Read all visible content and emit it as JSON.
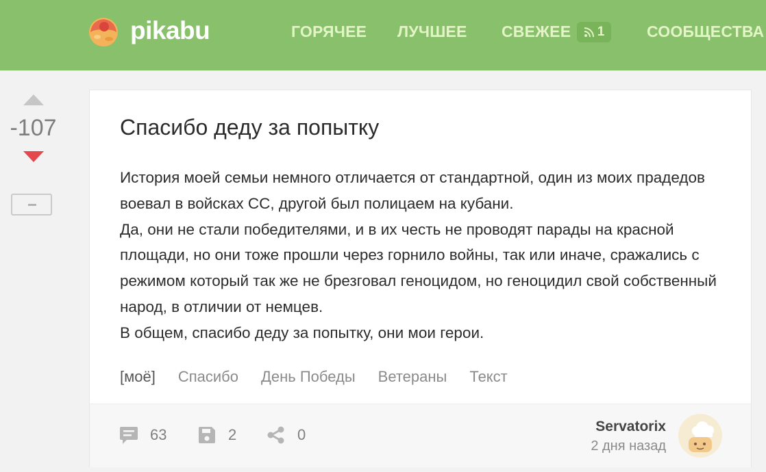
{
  "header": {
    "logo_text": "pikabu",
    "nav": {
      "hot": "ГОРЯЧЕЕ",
      "best": "ЛУЧШЕЕ",
      "fresh": "СВЕЖЕЕ",
      "communities": "СООБЩЕСТВА"
    },
    "fresh_badge_count": "1",
    "icons": {
      "logo": "cupcake-logo-icon",
      "badge": "rss-feed-icon"
    }
  },
  "colors": {
    "header_bg": "#88c06b",
    "nav_text": "#e3f5c6",
    "downvote_active": "#e4474d",
    "upvote": "#c6c6c6"
  },
  "post": {
    "rating": "-107",
    "title": "Спасибо деду за попытку",
    "paragraphs": [
      "История моей семьи немного отличается от стандартной, один из моих прадедов воевал в войсках СС, другой был полицаем на кубани.",
      "Да, они не стали победителями, и в их честь не проводят парады на красной площади, но они тоже прошли через горнило войны, так или иначе, сражались с режимом который так же не брезговал геноцидом, но геноцидил свой собственный народ, в отличии от немцев.",
      "В общем, спасибо деду за попытку, они мои герои."
    ],
    "tags": [
      "[моё]",
      "Спасибо",
      "День Победы",
      "Ветераны",
      "Текст"
    ],
    "comments_count": "63",
    "saves_count": "2",
    "shares_count": "0",
    "author": "Servatorix",
    "posted": "2 дня назад",
    "icons": {
      "upvote": "triangle-up-icon",
      "downvote": "triangle-down-icon",
      "hide": "minus-icon",
      "comments": "comment-icon",
      "saves": "floppy-disk-icon",
      "share": "share-icon",
      "avatar": "chef-avatar-icon"
    }
  }
}
